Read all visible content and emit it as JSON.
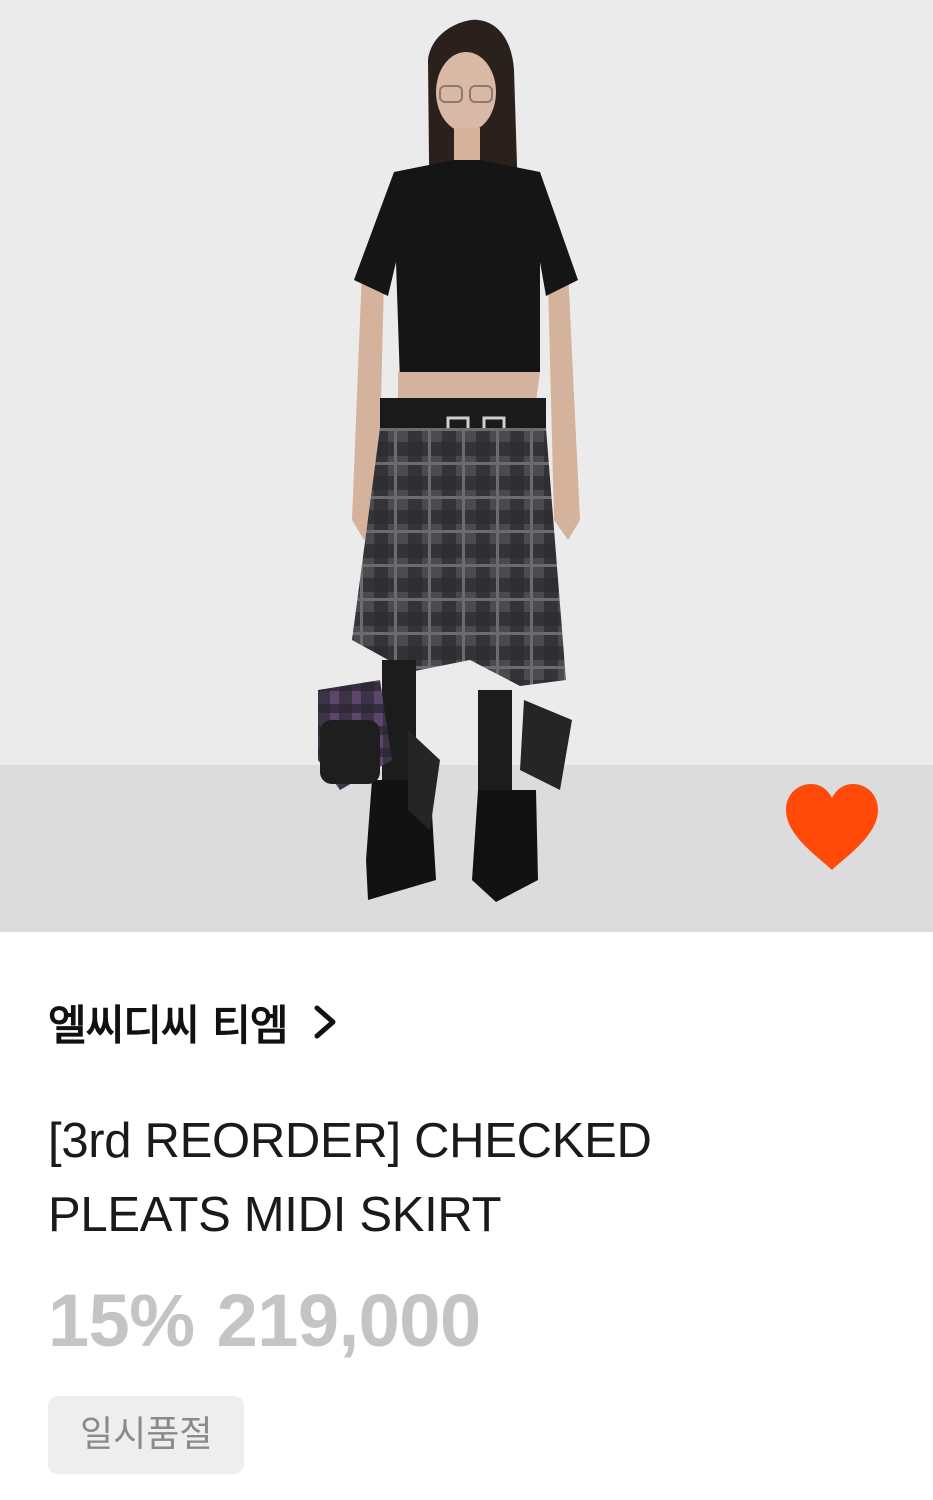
{
  "product": {
    "brand": "엘씨디씨 티엠",
    "title": "[3rd REORDER] CHECKED PLEATS MIDI SKIRT",
    "discount": "15%",
    "price": "219,000",
    "status_badge": "일시품절",
    "wishlisted": true
  },
  "icons": {
    "wishlist": "heart-icon",
    "brand_link": "chevron-right-icon"
  },
  "colors": {
    "heart": "#ff4a0a",
    "price_text": "#c4c4c4",
    "badge_bg": "#eeeeee",
    "badge_text": "#8a8a8a"
  }
}
